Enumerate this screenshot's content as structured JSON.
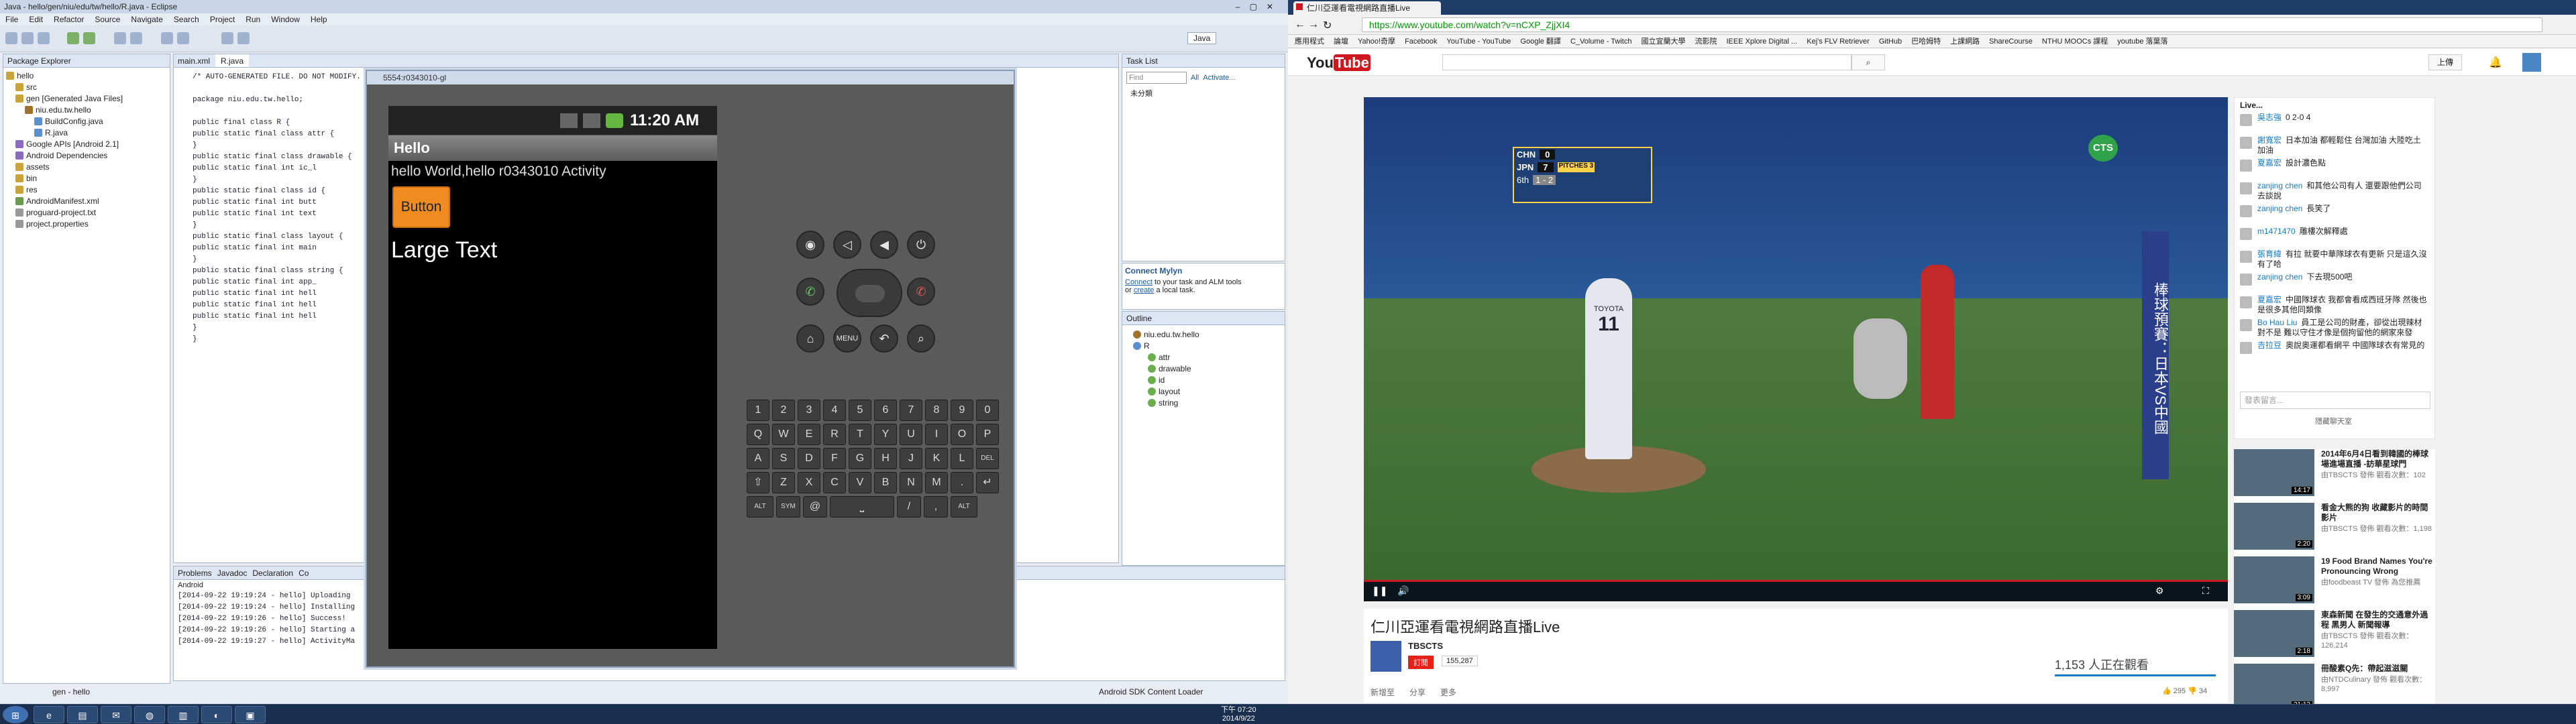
{
  "eclipse": {
    "title": "Java - hello/gen/niu/edu/tw/hello/R.java - Eclipse",
    "menu": [
      "File",
      "Edit",
      "Refactor",
      "Source",
      "Navigate",
      "Search",
      "Project",
      "Run",
      "Window",
      "Help"
    ],
    "perspective": "Java",
    "package_explorer": {
      "title": "Package Explorer",
      "items": [
        "hello",
        "src",
        "gen [Generated Java Files]",
        "niu.edu.tw.hello",
        "BuildConfig.java",
        "R.java",
        "Google APIs [Android 2.1]",
        "Android Dependencies",
        "assets",
        "bin",
        "res",
        "AndroidManifest.xml",
        "proguard-project.txt",
        "project.properties"
      ]
    },
    "editor_tabs": [
      "main.xml",
      "R.java"
    ],
    "code": [
      "/* AUTO-GENERATED FILE.  DO NOT MODIFY.",
      "",
      "package niu.edu.tw.hello;",
      "",
      "public final class R {",
      "    public static final class attr {",
      "    }",
      "    public static final class drawable {",
      "        public static final int ic_l",
      "    }",
      "    public static final class id {",
      "        public static final int butt",
      "        public static final int text",
      "    }",
      "    public static final class layout {",
      "        public static final int main",
      "    }",
      "    public static final class string {",
      "        public static final int app_",
      "        public static final int hell",
      "        public static final int hell",
      "        public static final int hell",
      "    }",
      "}"
    ],
    "task_list": {
      "title": "Task List",
      "find": "Find",
      "all": "All",
      "activate": "Activate...",
      "uncategorized": "未分類"
    },
    "mylyn": {
      "title": "Connect Mylyn",
      "text1": "Connect",
      "text2": "to your task and ALM tools",
      "text3": "or",
      "text4": "create",
      "text5": "a local task."
    },
    "outline": {
      "title": "Outline",
      "items": [
        "niu.edu.tw.hello",
        "R",
        "attr",
        "drawable",
        "id",
        "layout",
        "string"
      ]
    },
    "console": {
      "tabs": [
        "Problems",
        "Javadoc",
        "Declaration",
        "Co"
      ],
      "label": "Android",
      "lines": [
        "[2014-09-22 19:19:24 - hello] Uploading",
        "[2014-09-22 19:19:24 - hello] Installing",
        "[2014-09-22 19:19:26 - hello] Success!",
        "[2014-09-22 19:19:26 - hello] Starting a",
        "[2014-09-22 19:19:27 - hello] ActivityMa"
      ]
    },
    "status": {
      "left": "gen - hello",
      "right": "Android SDK Content Loader"
    }
  },
  "emulator": {
    "title": "5554:r0343010-gl",
    "time": "11:20 AM",
    "app_title": "Hello",
    "hello_text": "hello World,hello r0343010 Activity",
    "button": "Button",
    "large_text": "Large Text",
    "keyboard": [
      [
        "1",
        "2",
        "3",
        "4",
        "5",
        "6",
        "7",
        "8",
        "9",
        "0"
      ],
      [
        "Q",
        "W",
        "E",
        "R",
        "T",
        "Y",
        "U",
        "I",
        "O",
        "P"
      ],
      [
        "A",
        "S",
        "D",
        "F",
        "G",
        "H",
        "J",
        "K",
        "L",
        "DEL"
      ],
      [
        "⇧",
        "Z",
        "X",
        "C",
        "V",
        "B",
        "N",
        "M",
        ".",
        "↵"
      ],
      [
        "ALT",
        "SYM",
        "@",
        "⎵",
        "/",
        ",",
        "ALT"
      ]
    ],
    "menu_label": "MENU"
  },
  "browser": {
    "tab": "仁川亞運看電視網路直播Live",
    "url": "https://www.youtube.com/watch?v=nCXP_ZjjXI4",
    "bookmarks": [
      "應用程式",
      "論壇",
      "Yahoo!奇摩",
      "Facebook",
      "YouTube - YouTube",
      "Google 翻譯",
      "C_Volume - Twitch",
      "國立宜蘭大學",
      "流影院",
      "IEEE Xplore Digital ...",
      "Kej's FLV Retriever",
      "GitHub",
      "巴哈姆特",
      "上課網路",
      "ShareCourse",
      "NTHU MOOCs 課程",
      "",
      "youtube 落葉落"
    ],
    "upload": "上傳",
    "scoreboard": {
      "team1": "CHN",
      "score1": "0",
      "team2": "JPN",
      "score2": "7",
      "inning": "6th",
      "count": "1 - 2",
      "pitches": "PITCHES 3"
    },
    "banner": "棒球預賽：日本VS中國",
    "channel_logo": "CTS",
    "player_number": "11",
    "player_name": "TOYOTA",
    "video_title": "仁川亞運看電視網路直播Live",
    "channel": "TBSCTS",
    "subscribe": "訂閱",
    "subs": "155,287",
    "viewers": "1,153 人正在觀看",
    "likes": "295",
    "dislikes": "34",
    "actions": [
      "新增至",
      "分享",
      "更多"
    ],
    "chat_header": "Live...",
    "chat": [
      [
        "吳志強",
        "0 2-0 4"
      ],
      [
        "謝寬宏",
        "日本加油 都輕鬆住 台灣加油 大陸吃土加油"
      ],
      [
        "夏嘉宏",
        "設計濃色點"
      ],
      [
        "zanjing chen",
        "和其他公司有人 還要跟他們公司去談說"
      ],
      [
        "zanjing chen",
        "長笑了"
      ],
      [
        "m1471470",
        "雕樓次解釋處"
      ],
      [
        "張育緯",
        "有拉 就要中華隊球衣有更新 只是這久沒有了哈"
      ],
      [
        "zanjing chen",
        "下去現500吧"
      ],
      [
        "夏嘉宏",
        "中國隊球衣 我都會看成西班牙隊 然後也是很多其他同類像"
      ],
      [
        "Bo Hau Liu",
        "員工是公司的財產，卻從出現辣材對不是 難以守住才像是個拘留他的網家來發"
      ],
      [
        "吉拉豆",
        "奧說奧運都看網平 中國隊球衣有常見的"
      ]
    ],
    "chat_placeholder": "發表留言...",
    "chat_footer": "隱藏聊天室",
    "recs": [
      {
        "title": "2014年6月4日看到韓國的棒球場進場直播 -訪華星球門",
        "meta": "由TBSCTS 發佈 觀看次數：102",
        "dur": "14:17"
      },
      {
        "title": "看金大熊的狗 收藏影片的時間影片",
        "meta": "由TBSCTS 發佈 觀看次數：1,198",
        "dur": "2:20"
      },
      {
        "title": "19 Food Brand Names You're Pronouncing Wrong",
        "meta": "由foodbeast TV 發佈 為您推薦",
        "dur": "3:09"
      },
      {
        "title": "東森新聞 在發生的交通意外過程 黑男人 新聞報導",
        "meta": "由TBSCTS 發佈 觀看次數：126,214",
        "dur": "2:18"
      },
      {
        "title": "冊酸素Q先：帶起滋滋關",
        "meta": "由NTDCulinary 發佈 觀看次數：8,997",
        "dur": "21:13"
      }
    ]
  },
  "taskbar": {
    "time": "下午 07:20",
    "date": "2014/9/22"
  },
  "colors": {
    "accent": "#2b579a",
    "yt_red": "#cc181e",
    "android_orange": "#f08c1f"
  }
}
